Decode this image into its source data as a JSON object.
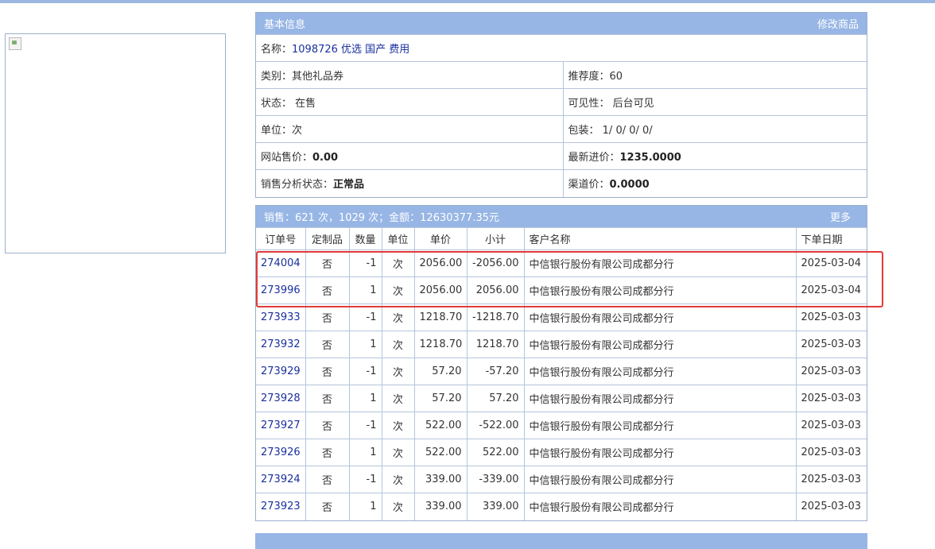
{
  "basic": {
    "title": "基本信息",
    "edit_link": "修改商品",
    "name_label": "名称：",
    "name_value": "1098726 优选 国产 费用",
    "category_label": "类别：",
    "category_value": "其他礼品券",
    "recommend_label": "推荐度：",
    "recommend_value": "60",
    "status_label": "状态：",
    "status_value": "在售",
    "visibility_label": "可见性：",
    "visibility_value": "后台可见",
    "unit_label": "单位：",
    "unit_value": "次",
    "package_label": "包装：",
    "package_value": "1/ 0/ 0/ 0/",
    "site_price_label": "网站售价：",
    "site_price_value": "0.00",
    "latest_cost_label": "最新进价：",
    "latest_cost_value": "1235.0000",
    "analysis_label": "销售分析状态：",
    "analysis_value": "正常品",
    "channel_price_label": "渠道价：",
    "channel_price_value": "0.0000"
  },
  "sales": {
    "summary": "销售：621 次，1029 次；金额：12630377.35元",
    "more_link": "更多",
    "columns": [
      "订单号",
      "定制品",
      "数量",
      "单位",
      "单价",
      "小计",
      "客户名称",
      "下单日期"
    ],
    "rows": [
      {
        "order": "274004",
        "custom": "否",
        "qty": "-1",
        "unit": "次",
        "price": "2056.00",
        "subtotal": "-2056.00",
        "customer": "中信银行股份有限公司成都分行",
        "date": "2025-03-04"
      },
      {
        "order": "273996",
        "custom": "否",
        "qty": "1",
        "unit": "次",
        "price": "2056.00",
        "subtotal": "2056.00",
        "customer": "中信银行股份有限公司成都分行",
        "date": "2025-03-04"
      },
      {
        "order": "273933",
        "custom": "否",
        "qty": "-1",
        "unit": "次",
        "price": "1218.70",
        "subtotal": "-1218.70",
        "customer": "中信银行股份有限公司成都分行",
        "date": "2025-03-03"
      },
      {
        "order": "273932",
        "custom": "否",
        "qty": "1",
        "unit": "次",
        "price": "1218.70",
        "subtotal": "1218.70",
        "customer": "中信银行股份有限公司成都分行",
        "date": "2025-03-03"
      },
      {
        "order": "273929",
        "custom": "否",
        "qty": "-1",
        "unit": "次",
        "price": "57.20",
        "subtotal": "-57.20",
        "customer": "中信银行股份有限公司成都分行",
        "date": "2025-03-03"
      },
      {
        "order": "273928",
        "custom": "否",
        "qty": "1",
        "unit": "次",
        "price": "57.20",
        "subtotal": "57.20",
        "customer": "中信银行股份有限公司成都分行",
        "date": "2025-03-03"
      },
      {
        "order": "273927",
        "custom": "否",
        "qty": "-1",
        "unit": "次",
        "price": "522.00",
        "subtotal": "-522.00",
        "customer": "中信银行股份有限公司成都分行",
        "date": "2025-03-03"
      },
      {
        "order": "273926",
        "custom": "否",
        "qty": "1",
        "unit": "次",
        "price": "522.00",
        "subtotal": "522.00",
        "customer": "中信银行股份有限公司成都分行",
        "date": "2025-03-03"
      },
      {
        "order": "273924",
        "custom": "否",
        "qty": "-1",
        "unit": "次",
        "price": "339.00",
        "subtotal": "-339.00",
        "customer": "中信银行股份有限公司成都分行",
        "date": "2025-03-03"
      },
      {
        "order": "273923",
        "custom": "否",
        "qty": "1",
        "unit": "次",
        "price": "339.00",
        "subtotal": "339.00",
        "customer": "中信银行股份有限公司成都分行",
        "date": "2025-03-03"
      }
    ]
  },
  "icons": {
    "product_image": "broken-image-icon"
  },
  "colors": {
    "header_bg": "#97b6e5",
    "link": "#1a2f9e",
    "highlight": "#e23a3a"
  }
}
